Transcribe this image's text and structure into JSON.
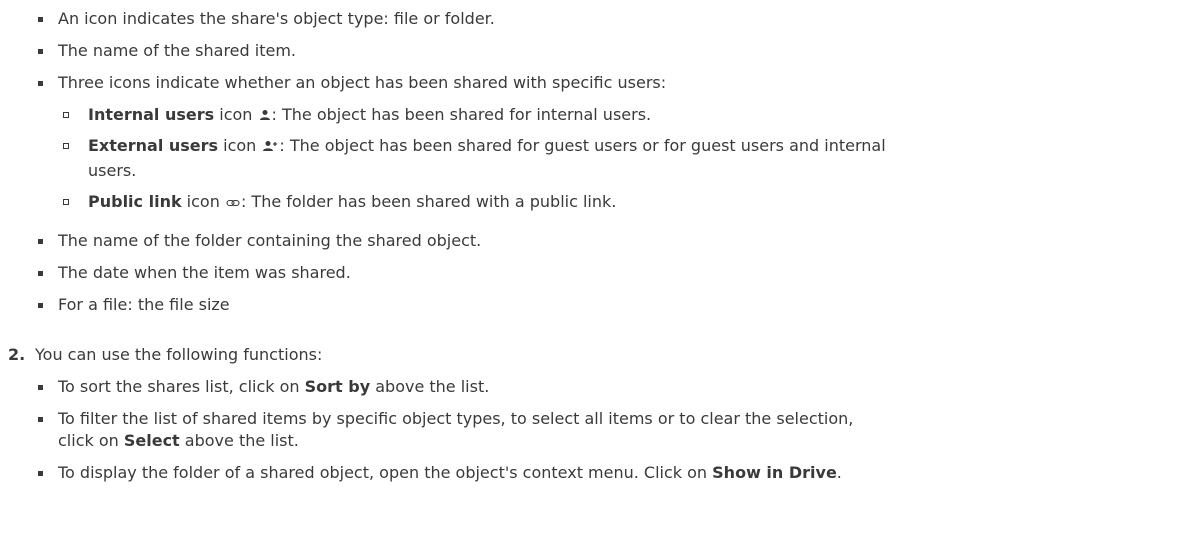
{
  "first_list": [
    "An icon indicates the share's object type: file or folder.",
    "The name of the shared item.",
    "Three icons indicate whether an object has been shared with specific users:"
  ],
  "icon_list": [
    {
      "bold": "Internal users",
      "text_a": " icon ",
      "icon": "user-icon",
      "text_b": ": The object has been shared for internal users."
    },
    {
      "bold": "External users",
      "text_a": " icon ",
      "icon": "user-plus-icon",
      "text_b": ": The object has been shared for guest users or for guest users and internal",
      "text_c": "users."
    },
    {
      "bold": "Public link",
      "text_a": " icon ",
      "icon": "link-icon",
      "text_b": ": The folder has been shared with a public link."
    }
  ],
  "second_list": [
    "The name of the folder containing the shared object.",
    "The date when the item was shared.",
    "For a file: the file size"
  ],
  "step2": {
    "number": "2.",
    "text": "You can use the following functions:"
  },
  "functions": [
    {
      "a": "To sort the shares list, click on ",
      "bold": "Sort by",
      "b": " above the list."
    },
    {
      "a": "To filter the list of shared items by specific object types, to select all items or to clear the selection,",
      "a2": "click on ",
      "bold": "Select",
      "b": " above the list."
    },
    {
      "a": "To display the folder of a shared object, open the object's context menu. Click on ",
      "bold": "Show in Drive",
      "b": "."
    }
  ]
}
